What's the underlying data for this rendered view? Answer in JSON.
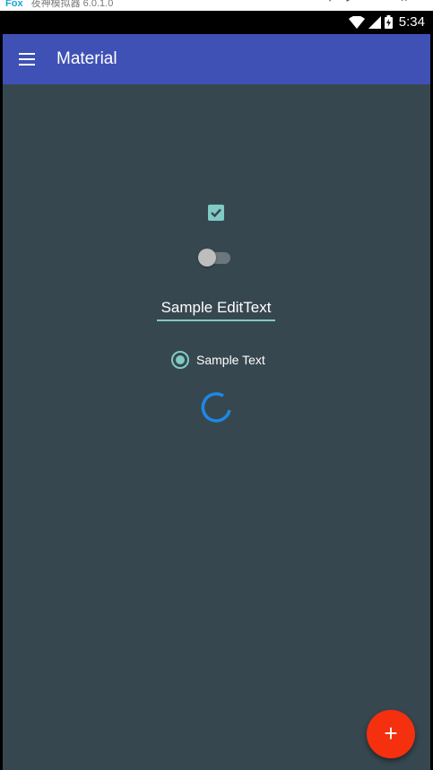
{
  "emulator": {
    "brand": "Fox",
    "title": "夜神模拟器 6.0.1.0"
  },
  "status_bar": {
    "time": "5:34"
  },
  "app_bar": {
    "title": "Material",
    "menu_icon": "hamburger-menu-icon"
  },
  "content": {
    "checkbox": {
      "checked": true
    },
    "switch": {
      "on": false
    },
    "edit_text": {
      "value": "Sample EditText"
    },
    "radio": {
      "label": "Sample Text",
      "checked": true
    },
    "progress": {
      "type": "indeterminate-circular"
    }
  },
  "fab": {
    "label": "+"
  },
  "colors": {
    "app_bar": "#3f51b5",
    "background": "#37474f",
    "accent": "#80cbc4",
    "fab": "#f4300f",
    "spinner": "#1e88e5"
  }
}
